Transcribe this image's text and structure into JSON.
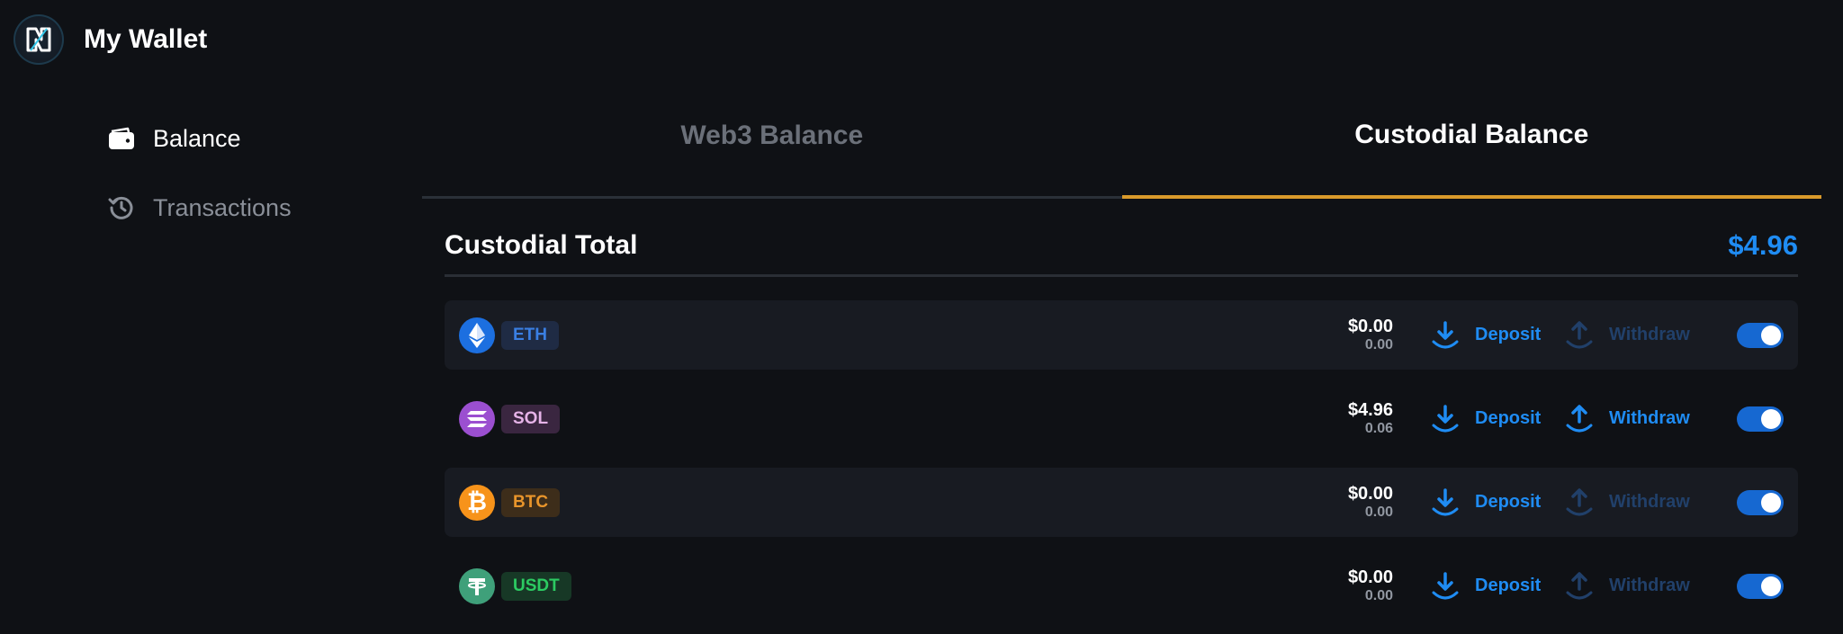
{
  "app": {
    "title": "My Wallet",
    "logo": "nx-logo"
  },
  "sidebar": {
    "items": [
      {
        "label": "Balance",
        "icon": "wallet-icon",
        "active": true
      },
      {
        "label": "Transactions",
        "icon": "history-icon",
        "active": false
      }
    ]
  },
  "tabs": [
    {
      "label": "Web3 Balance",
      "active": false
    },
    {
      "label": "Custodial Balance",
      "active": true
    }
  ],
  "summary": {
    "label": "Custodial Total",
    "value": "$4.96"
  },
  "assets": [
    {
      "ticker": "ETH",
      "icon": "eth-icon",
      "usd": "$0.00",
      "qty": "0.00",
      "deposit": "Deposit",
      "withdraw": "Withdraw",
      "withdraw_enabled": false,
      "enabled": true
    },
    {
      "ticker": "SOL",
      "icon": "sol-icon",
      "usd": "$4.96",
      "qty": "0.06",
      "deposit": "Deposit",
      "withdraw": "Withdraw",
      "withdraw_enabled": true,
      "enabled": true
    },
    {
      "ticker": "BTC",
      "icon": "btc-icon",
      "usd": "$0.00",
      "qty": "0.00",
      "deposit": "Deposit",
      "withdraw": "Withdraw",
      "withdraw_enabled": false,
      "enabled": true
    },
    {
      "ticker": "USDT",
      "icon": "usdt-icon",
      "usd": "$0.00",
      "qty": "0.00",
      "deposit": "Deposit",
      "withdraw": "Withdraw",
      "withdraw_enabled": false,
      "enabled": true
    }
  ],
  "colors": {
    "background": "#0f1115",
    "accent_blue": "#1f8cf3",
    "tab_active_underline": "#d99a2b",
    "eth": "#1c6fe0",
    "sol": "#9b4fd0",
    "btc": "#f7931a",
    "usdt": "#3fa07a"
  }
}
